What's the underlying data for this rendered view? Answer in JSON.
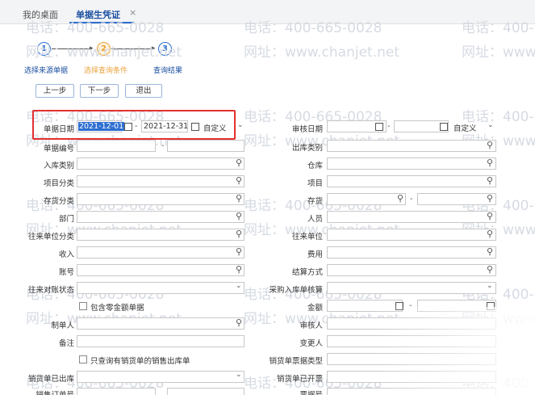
{
  "tabs": [
    {
      "label": "我的桌面"
    },
    {
      "label": "单据生凭证"
    }
  ],
  "tab_close": "×",
  "steps": [
    {
      "num": "1",
      "label": "选择来源单据",
      "state": "done"
    },
    {
      "num": "2",
      "label": "选择查询条件",
      "state": "current"
    },
    {
      "num": "3",
      "label": "查询结果",
      "state": "todo"
    }
  ],
  "buttons": {
    "prev": "上一步",
    "next": "下一步",
    "exit": "退出"
  },
  "left_fields": {
    "doc_date": "单据日期",
    "date_from": "2021-12-01",
    "date_to": "2021-12-31",
    "date_mode": "自定义",
    "doc_no": "单据编号",
    "in_type": "入库类别",
    "item_category": "项目分类",
    "inventory_category": "存货分类",
    "dept": "部门",
    "partner_category": "往来单位分类",
    "income": "收入",
    "account": "账号",
    "reconcile_status": "往来对账状态",
    "include_zero": "包含零金额单据",
    "maker": "制单人",
    "remark": "备注",
    "only_sales_out": "只查询有销货单的销售出库单",
    "sales_out": "销货单已出库",
    "sales_order": "销售订单号"
  },
  "right_fields": {
    "audit_date": "审核日期",
    "date_mode": "自定义",
    "out_type": "出库类别",
    "warehouse": "仓库",
    "item": "项目",
    "inventory": "存货",
    "person": "人员",
    "partner": "往来单位",
    "expense": "费用",
    "settle_method": "结算方式",
    "purchase_in_settle": "采购入库单核算",
    "amount": "金额",
    "auditor": "审核人",
    "changer": "变更人",
    "sales_invoice_type": "销货单票据类型",
    "sales_invoiced": "销货单已开票",
    "voucher_no": "票据号"
  },
  "watermark": {
    "phone": "电话：400-665-0028",
    "site": "网址：www.chanjet.net"
  },
  "icons": {
    "search": "search-icon",
    "calendar": "calendar-icon",
    "dropdown": "chevron-down-icon"
  },
  "colors": {
    "accent": "#2e6fd1",
    "current_step": "#e8a23a",
    "highlight": "#e33131"
  }
}
